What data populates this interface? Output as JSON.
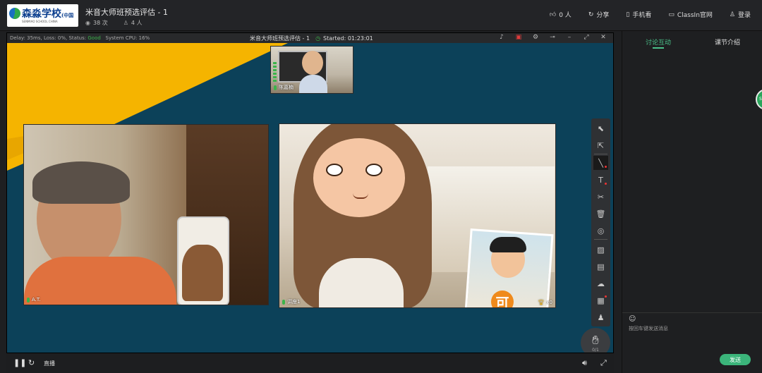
{
  "header": {
    "logo_text": "森淼学校",
    "logo_suffix": "(中国",
    "logo_sub": "SENMIAO SCHOOL CHINA",
    "class_title": "米音大师班预选评估 - 1",
    "views": "38 次",
    "members": "4 人",
    "actions": {
      "likes": "0 人",
      "share": "分享",
      "phone": "手机看",
      "website": "ClassIn官网",
      "login": "登录"
    }
  },
  "status": {
    "delay": "Delay: 35ms, Loss: 0%, Status:",
    "status_value": "Good",
    "cpu": "System CPU: 16%",
    "title": "米音大师班预选评估 - 1",
    "started": "Started: 01:23:01"
  },
  "videos": {
    "teacher_name": "陈嘉楠",
    "student_name": "A.T.",
    "main_name": "讲座1",
    "trophy_count": "x0",
    "sticker_char": "可"
  },
  "toolbar": {
    "icons": [
      "select-icon",
      "pointer-icon",
      "pen-icon",
      "text-icon",
      "scissors-icon",
      "trash-icon",
      "record-icon",
      "image-icon",
      "chat-icon",
      "cloud-icon",
      "box-icon",
      "people-icon"
    ]
  },
  "hand": {
    "count": "0/1"
  },
  "bottom": {
    "live_label": "直播"
  },
  "panel": {
    "tab_discussion": "讨论互动",
    "tab_course": "课节介绍",
    "input_placeholder": "按回车键发送消息",
    "send_label": "发送",
    "floater_text": "Se"
  },
  "colors": {
    "stage": "#0c4159",
    "yellow": "#f5b400",
    "accent": "#3bb47a"
  }
}
